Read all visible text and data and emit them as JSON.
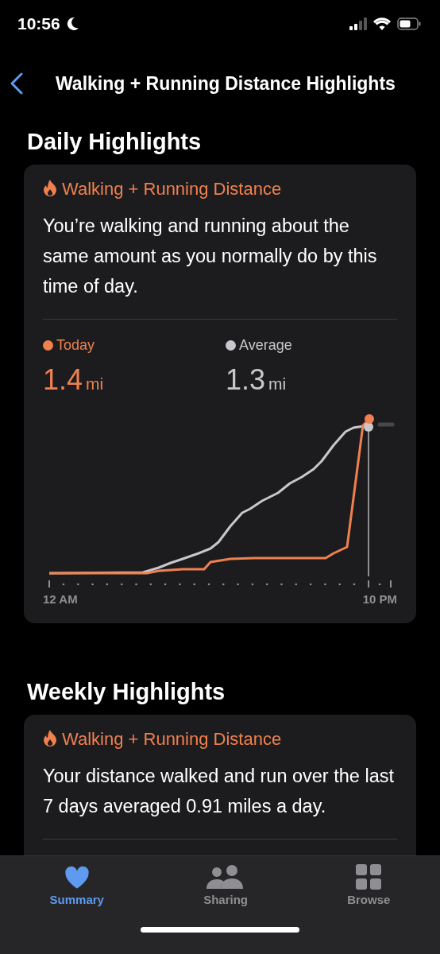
{
  "status_bar": {
    "time": "10:56"
  },
  "nav": {
    "title": "Walking + Running Distance Highlights"
  },
  "sections": [
    {
      "heading": "Daily Highlights",
      "card": {
        "title": "Walking + Running Distance",
        "text": "You’re walking and running about the same amount as you normally do by this time of day.",
        "legend": [
          {
            "label": "Today",
            "value": "1.4",
            "unit": "mi",
            "color": "#f0804f"
          },
          {
            "label": "Average",
            "value": "1.3",
            "unit": "mi",
            "color": "#c7c7cc"
          }
        ],
        "axis_labels": [
          "12 AM",
          "10 PM"
        ]
      }
    },
    {
      "heading": "Weekly Highlights",
      "card": {
        "title": "Walking + Running Distance",
        "text": "Your distance walked and run over the last 7 days averaged 0.91 miles a day."
      }
    }
  ],
  "tabs": [
    {
      "label": "Summary",
      "selected": true
    },
    {
      "label": "Sharing",
      "selected": false
    },
    {
      "label": "Browse",
      "selected": false
    }
  ]
}
